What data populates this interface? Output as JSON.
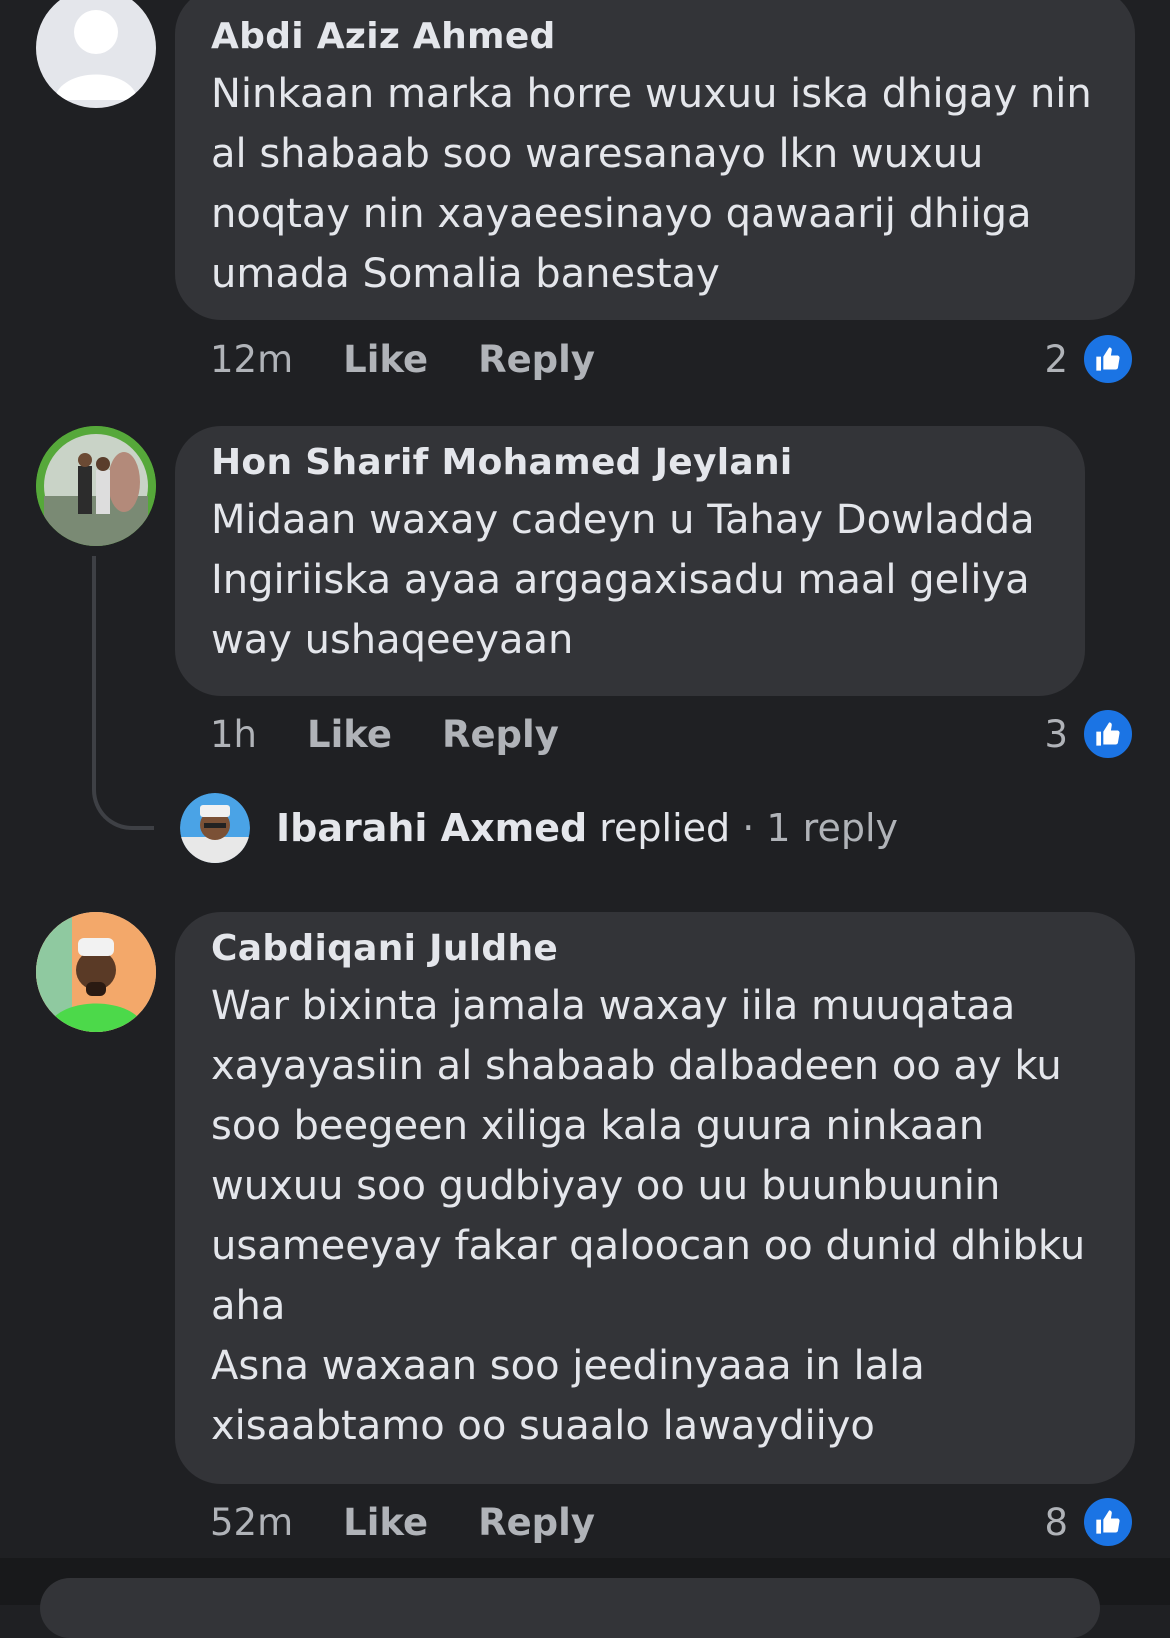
{
  "comments": [
    {
      "author": "Abdi Aziz Ahmed",
      "text": "Ninkaan marka horre wuxuu iska dhigay nin\nal shabaab soo waresanayo lkn wuxuu\nnoqtay nin xayaeesinayo qawaarij dhiiga\numada Somalia banestay",
      "time": "12m",
      "like_label": "Like",
      "reply_label": "Reply",
      "reaction_count": "2"
    },
    {
      "author": "Hon Sharif Mohamed Jeylani",
      "text": "Midaan waxay cadeyn u Tahay Dowladda\nIngiriiska ayaa argagaxisadu maal geliya\nway ushaqeeyaan",
      "time": "1h",
      "like_label": "Like",
      "reply_label": "Reply",
      "reaction_count": "3",
      "reply_summary": {
        "name": "Ibarahi Axmed",
        "action": "replied",
        "count": "· 1 reply"
      }
    },
    {
      "author": "Cabdiqani Juldhe",
      "text": "War bixinta jamala waxay iila muuqataa\nxayayasiin al shabaab dalbadeen oo ay ku\nsoo beegeen xiliga kala guura ninkaan\nwuxuu soo gudbiyay oo uu buunbuunin\nusameeyay fakar qaloocan oo dunid dhibku\naha\nAsna waxaan soo jeedinyaaa in lala\nxisaabtamo oo suaalo lawaydiiyo",
      "time": "52m",
      "like_label": "Like",
      "reply_label": "Reply",
      "reaction_count": "8"
    }
  ],
  "colors": {
    "background": "#1f2023",
    "bubble": "#333438",
    "like_badge": "#1b74e4"
  },
  "icons": {
    "reaction": "thumbs-up-icon",
    "default_avatar": "person-silhouette-icon"
  }
}
